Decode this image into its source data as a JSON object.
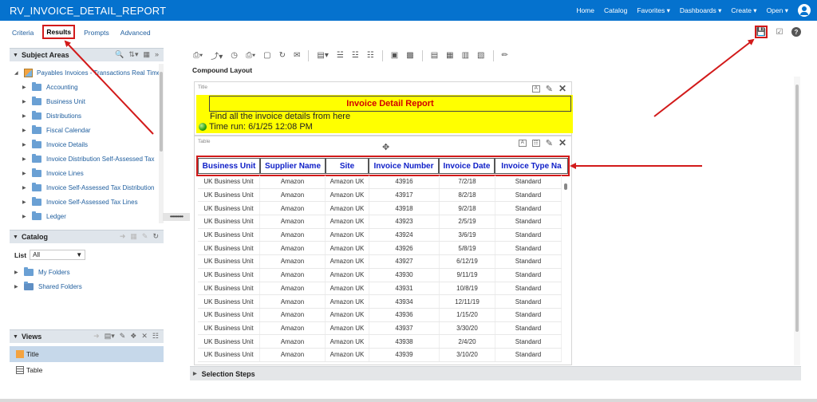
{
  "header": {
    "title": "RV_INVOICE_DETAIL_REPORT",
    "nav": [
      "Home",
      "Catalog",
      "Favorites",
      "Dashboards",
      "Create",
      "Open"
    ]
  },
  "tabs": [
    "Criteria",
    "Results",
    "Prompts",
    "Advanced"
  ],
  "subject_areas": {
    "title": "Subject Areas",
    "root": "Payables Invoices - Transactions Real Time",
    "items": [
      "Accounting",
      "Business Unit",
      "Distributions",
      "Fiscal Calendar",
      "Invoice Details",
      "Invoice Distribution Self-Assessed Tax",
      "Invoice Lines",
      "Invoice Self-Assessed Tax Distribution",
      "Invoice Self-Assessed Tax Lines",
      "Ledger"
    ]
  },
  "catalog": {
    "title": "Catalog",
    "list_label": "List",
    "list_value": "All",
    "folders": [
      "My Folders",
      "Shared Folders"
    ]
  },
  "views": {
    "title": "Views",
    "items": [
      "Title",
      "Table"
    ]
  },
  "compound_layout_label": "Compound Layout",
  "title_view": {
    "tag": "Title",
    "report_title": "Invoice Detail Report",
    "subtitle": "Find all the invoice details from here",
    "time_run": "Time run: 6/1/25 12:08 PM"
  },
  "table_view": {
    "tag": "Table",
    "columns": [
      "Business Unit",
      "Supplier Name",
      "Site",
      "Invoice Number",
      "Invoice Date",
      "Invoice Type Na"
    ],
    "rows": [
      [
        "UK Business Unit",
        "Amazon",
        "Amazon UK",
        "43916",
        "7/2/18",
        "Standard"
      ],
      [
        "UK Business Unit",
        "Amazon",
        "Amazon UK",
        "43917",
        "8/2/18",
        "Standard"
      ],
      [
        "UK Business Unit",
        "Amazon",
        "Amazon UK",
        "43918",
        "9/2/18",
        "Standard"
      ],
      [
        "UK Business Unit",
        "Amazon",
        "Amazon UK",
        "43923",
        "2/5/19",
        "Standard"
      ],
      [
        "UK Business Unit",
        "Amazon",
        "Amazon UK",
        "43924",
        "3/6/19",
        "Standard"
      ],
      [
        "UK Business Unit",
        "Amazon",
        "Amazon UK",
        "43926",
        "5/8/19",
        "Standard"
      ],
      [
        "UK Business Unit",
        "Amazon",
        "Amazon UK",
        "43927",
        "6/12/19",
        "Standard"
      ],
      [
        "UK Business Unit",
        "Amazon",
        "Amazon UK",
        "43930",
        "9/11/19",
        "Standard"
      ],
      [
        "UK Business Unit",
        "Amazon",
        "Amazon UK",
        "43931",
        "10/8/19",
        "Standard"
      ],
      [
        "UK Business Unit",
        "Amazon",
        "Amazon UK",
        "43934",
        "12/11/19",
        "Standard"
      ],
      [
        "UK Business Unit",
        "Amazon",
        "Amazon UK",
        "43936",
        "1/15/20",
        "Standard"
      ],
      [
        "UK Business Unit",
        "Amazon",
        "Amazon UK",
        "43937",
        "3/30/20",
        "Standard"
      ],
      [
        "UK Business Unit",
        "Amazon",
        "Amazon UK",
        "43938",
        "2/4/20",
        "Standard"
      ],
      [
        "UK Business Unit",
        "Amazon",
        "Amazon UK",
        "43939",
        "3/10/20",
        "Standard"
      ]
    ]
  },
  "selection_steps": "Selection Steps",
  "colors": {
    "header_bg": "#0572ce",
    "annotation_red": "#d21a1a",
    "title_band": "#ffff00",
    "column_header_text": "#1020c8"
  }
}
